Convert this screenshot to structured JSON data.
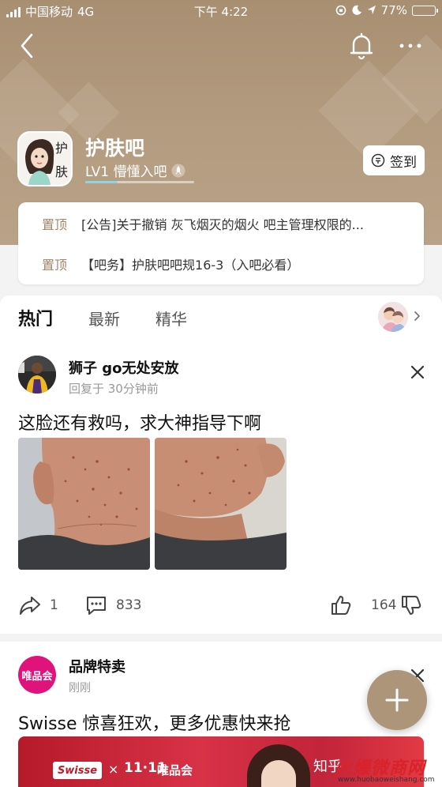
{
  "status_bar": {
    "carrier": "中国移动",
    "network": "4G",
    "time": "下午 4:22",
    "battery_pct": "77%",
    "battery_level": 0.77
  },
  "colors": {
    "header_brown": "#ad9579",
    "accent_tag": "#a0866a",
    "brand_pink": "#e0137c",
    "level_bar": "#8fd3e8"
  },
  "forum": {
    "name": "护肤吧",
    "level_text": "LV1 懵懂入吧",
    "level_progress": 0.3,
    "avatar_text": [
      "护",
      "肤"
    ],
    "signin_label": "签到"
  },
  "pinned": [
    {
      "tag": "置顶",
      "text": "[公告]关于撤销 灰飞烟灭的烟火 吧主管理权限的..."
    },
    {
      "tag": "置顶",
      "text": "【吧务】护肤吧吧规16-3（入吧必看）"
    }
  ],
  "tabs": [
    {
      "label": "热门",
      "active": true
    },
    {
      "label": "最新",
      "active": false
    },
    {
      "label": "精华",
      "active": false
    }
  ],
  "post1": {
    "author": "狮子 go无处安放",
    "meta": "回复于 30分钟前",
    "title": "这脸还有救吗，求大神指导下啊",
    "share_count": "1",
    "comment_count": "833",
    "like_count": "164"
  },
  "post2": {
    "author": "品牌特卖",
    "avatar_text": "唯品会",
    "meta": "刚刚",
    "title": "Swisse 惊喜狂欢，更多优惠快来抢",
    "banner": {
      "swisse": "Swisse",
      "times": "×",
      "event": "11·11",
      "vip": "唯品会",
      "zhihu": "知乎"
    }
  },
  "watermark": {
    "main": "火爆微商网",
    "sub": "www.huobaoweishang.com"
  },
  "icons": [
    "back-icon",
    "bell-icon",
    "more-icon",
    "signin-icon",
    "rocket-icon",
    "chevron-right-icon",
    "close-icon",
    "share-icon",
    "comment-icon",
    "thumbs-up-icon",
    "thumbs-down-icon",
    "plus-icon"
  ]
}
